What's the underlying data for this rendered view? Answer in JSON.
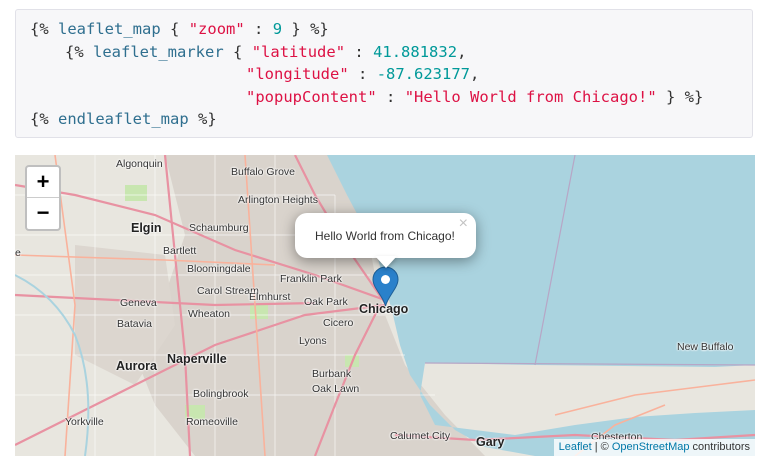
{
  "code": {
    "line1": {
      "open": "{%",
      "tag": "leaflet_map",
      "brace": "{",
      "key": "\"zoom\"",
      "colon": ":",
      "value": "9",
      "close": "} %}"
    },
    "line2": {
      "open": "{%",
      "tag": "leaflet_marker",
      "brace": "{",
      "key": "\"latitude\"",
      "colon": ":",
      "value": "41.881832",
      "comma": ","
    },
    "line3": {
      "key": "\"longitude\"",
      "colon": ":",
      "value": "-87.623177",
      "comma": ","
    },
    "line4": {
      "key": "\"popupContent\"",
      "colon": ":",
      "value": "\"Hello World from Chicago!\"",
      "close": "} %}"
    },
    "line5": {
      "open": "{%",
      "tag": "endleaflet_map",
      "close": "%}"
    }
  },
  "map": {
    "zoom_in": "+",
    "zoom_out": "−",
    "popup_text": "Hello World from Chicago!",
    "popup_close": "×",
    "places": {
      "algonquin": "Algonquin",
      "buffalo_grove": "Buffalo Grove",
      "arlington_heights": "Arlington Heights",
      "schaumburg": "Schaumburg",
      "elgin": "Elgin",
      "bartlett": "Bartlett",
      "bloomingdale": "Bloomingdale",
      "carol_stream": "Carol Stream",
      "franklin_park": "Franklin Park",
      "elmhurst": "Elmhurst",
      "oak_park": "Oak Park",
      "cicero": "Cicero",
      "chicago": "Chicago",
      "geneva": "Geneva",
      "wheaton": "Wheaton",
      "batavia": "Batavia",
      "lyons": "Lyons",
      "naperville": "Naperville",
      "aurora": "Aurora",
      "burbank": "Burbank",
      "oak_lawn": "Oak Lawn",
      "bolingbrook": "Bolingbrook",
      "yorkville": "Yorkville",
      "romeoville": "Romeoville",
      "calumet_city": "Calumet City",
      "gary": "Gary",
      "new_buffalo": "New Buffalo",
      "chesterton": "Chesterton",
      "e": "e"
    },
    "attribution": {
      "leaflet": "Leaflet",
      "separator": " | © ",
      "osm": "OpenStreetMap",
      "suffix": " contributors"
    },
    "colors": {
      "water": "#aad3df",
      "land": "#e8e6df",
      "urban": "#d9d3cc",
      "highway": "#e892a2",
      "trunk": "#f9b29c",
      "park": "#c8e6b0",
      "marker": "#2a81cb"
    }
  }
}
